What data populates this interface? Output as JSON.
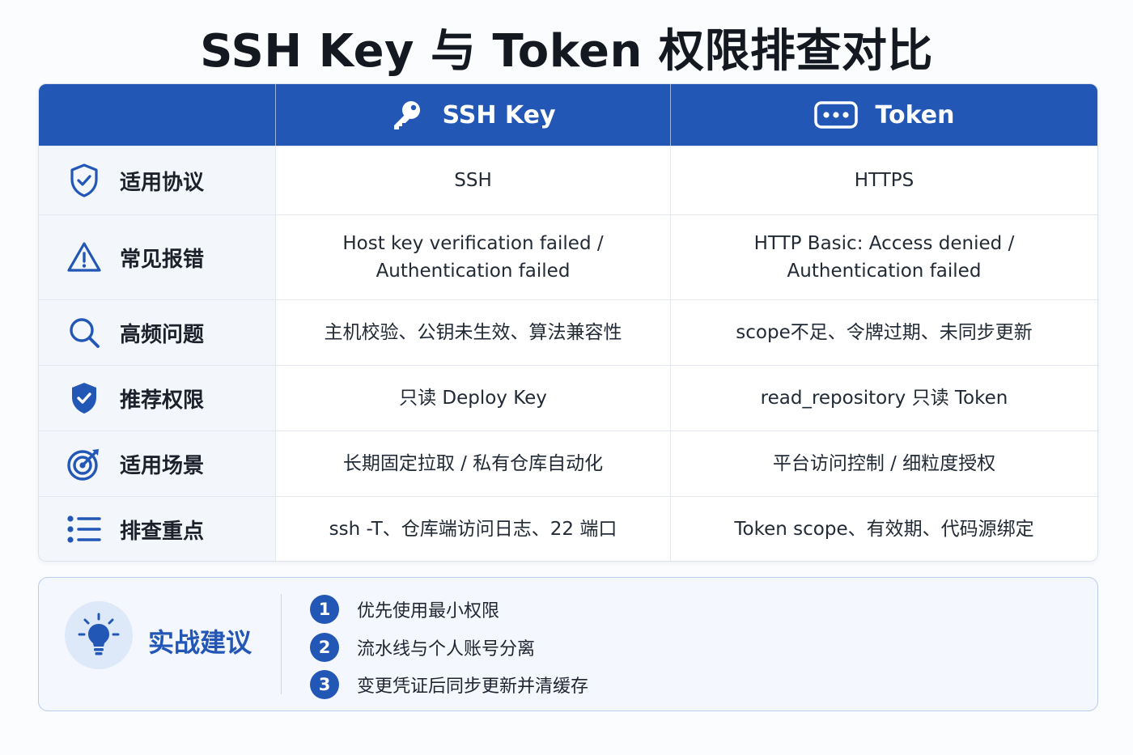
{
  "title": "SSH Key 与 Token 权限排查对比",
  "header": {
    "ssh_label": "SSH Key",
    "token_label": "Token",
    "ssh_icon": "key-icon",
    "token_icon": "password-dots-icon"
  },
  "rows": [
    {
      "label": "适用协议",
      "icon": "shield-check-icon",
      "ssh": "SSH",
      "token": "HTTPS"
    },
    {
      "label": "常见报错",
      "icon": "warning-icon",
      "ssh": "Host key verification failed /\nAuthentication failed",
      "token": "HTTP Basic: Access denied /\nAuthentication failed"
    },
    {
      "label": "高频问题",
      "icon": "search-icon",
      "ssh": "主机校验、公钥未生效、算法兼容性",
      "token": "scope不足、令牌过期、未同步更新"
    },
    {
      "label": "推荐权限",
      "icon": "shield-filled-check-icon",
      "ssh": "只读 Deploy Key",
      "token": "read_repository 只读 Token"
    },
    {
      "label": "适用场景",
      "icon": "target-icon",
      "ssh": "长期固定拉取 / 私有仓库自动化",
      "token": "平台访问控制 / 细粒度授权"
    },
    {
      "label": "排查重点",
      "icon": "list-icon",
      "ssh": "ssh -T、仓库端访问日志、22 端口",
      "token": "Token scope、有效期、代码源绑定"
    }
  ],
  "tips": {
    "title": "实战建议",
    "icon": "lightbulb-icon",
    "items": [
      {
        "num": "1",
        "text": "优先使用最小权限"
      },
      {
        "num": "2",
        "text": "流水线与个人账号分离"
      },
      {
        "num": "3",
        "text": "变更凭证后同步更新并清缓存"
      }
    ]
  },
  "colors": {
    "accent": "#2257b6",
    "header_bg": "#2257b6",
    "label_bg": "#f3f6fb",
    "tips_bg": "#f4f7fd"
  }
}
